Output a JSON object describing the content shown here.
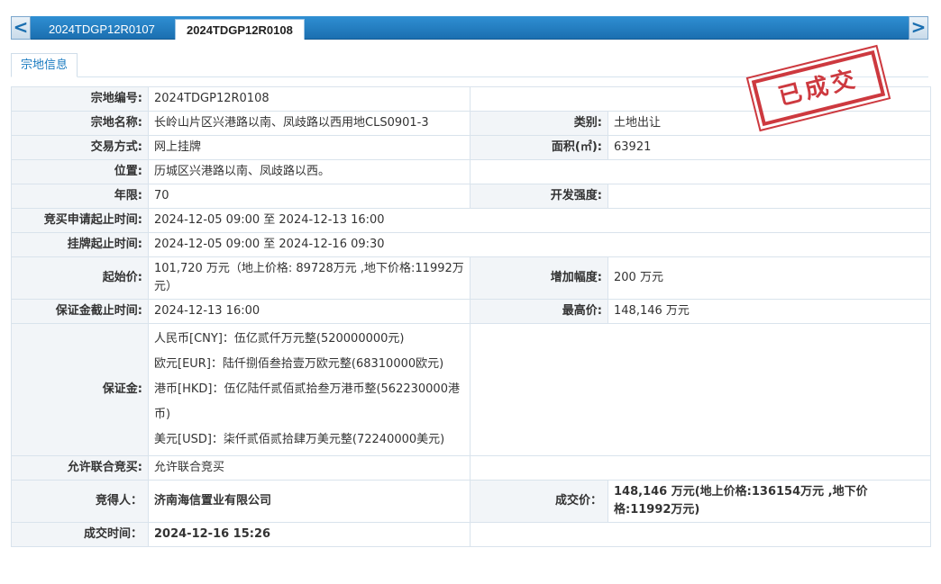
{
  "tabs": {
    "prev_label": "<",
    "next_label": ">",
    "items": [
      "2024TDGP12R0107",
      "2024TDGP12R0108"
    ],
    "active": "2024TDGP12R0108"
  },
  "section_tab": "宗地信息",
  "stamp": "已成交",
  "fields": {
    "parcel_no_label": "宗地编号:",
    "parcel_no": "2024TDGP12R0108",
    "parcel_name_label": "宗地名称:",
    "parcel_name": "长岭山片区兴港路以南、凤歧路以西用地CLS0901-3",
    "category_label": "类别:",
    "category": "土地出让",
    "trade_method_label": "交易方式:",
    "trade_method": "网上挂牌",
    "area_label": "面积(㎡):",
    "area": "63921",
    "location_label": "位置:",
    "location": "历城区兴港路以南、凤歧路以西。",
    "years_label": "年限:",
    "years": "70",
    "dev_intensity_label": "开发强度:",
    "dev_intensity": "",
    "apply_period_label": "竞买申请起止时间:",
    "apply_period": "2024-12-05 09:00 至 2024-12-13 16:00",
    "listing_period_label": "挂牌起止时间:",
    "listing_period": "2024-12-05 09:00 至 2024-12-16 09:30",
    "start_price_label": "起始价:",
    "start_price": "101,720 万元（地上价格: 89728万元 ,地下价格:11992万元）",
    "increment_label": "增加幅度:",
    "increment": "200 万元",
    "deposit_deadline_label": "保证金截止时间:",
    "deposit_deadline": "2024-12-13 16:00",
    "highest_price_label": "最高价:",
    "highest_price": "148,146 万元",
    "deposit_label": "保证金:",
    "deposit_lines": [
      "人民币[CNY]：伍亿贰仟万元整(520000000元)",
      "欧元[EUR]：陆仟捌佰叁拾壹万欧元整(68310000欧元)",
      "港币[HKD]：伍亿陆仟贰佰贰拾叁万港币整(562230000港币)",
      "美元[USD]：柒仟贰佰贰拾肆万美元整(72240000美元)"
    ],
    "joint_bid_label": "允许联合竞买:",
    "joint_bid": "允许联合竞买",
    "winner_label": "竞得人：",
    "winner": "济南海信置业有限公司",
    "deal_price_label": "成交价：",
    "deal_price": "148,146 万元(地上价格:136154万元 ,地下价格:11992万元)",
    "deal_time_label": "成交时间：",
    "deal_time": "2024-12-16 15:26"
  }
}
